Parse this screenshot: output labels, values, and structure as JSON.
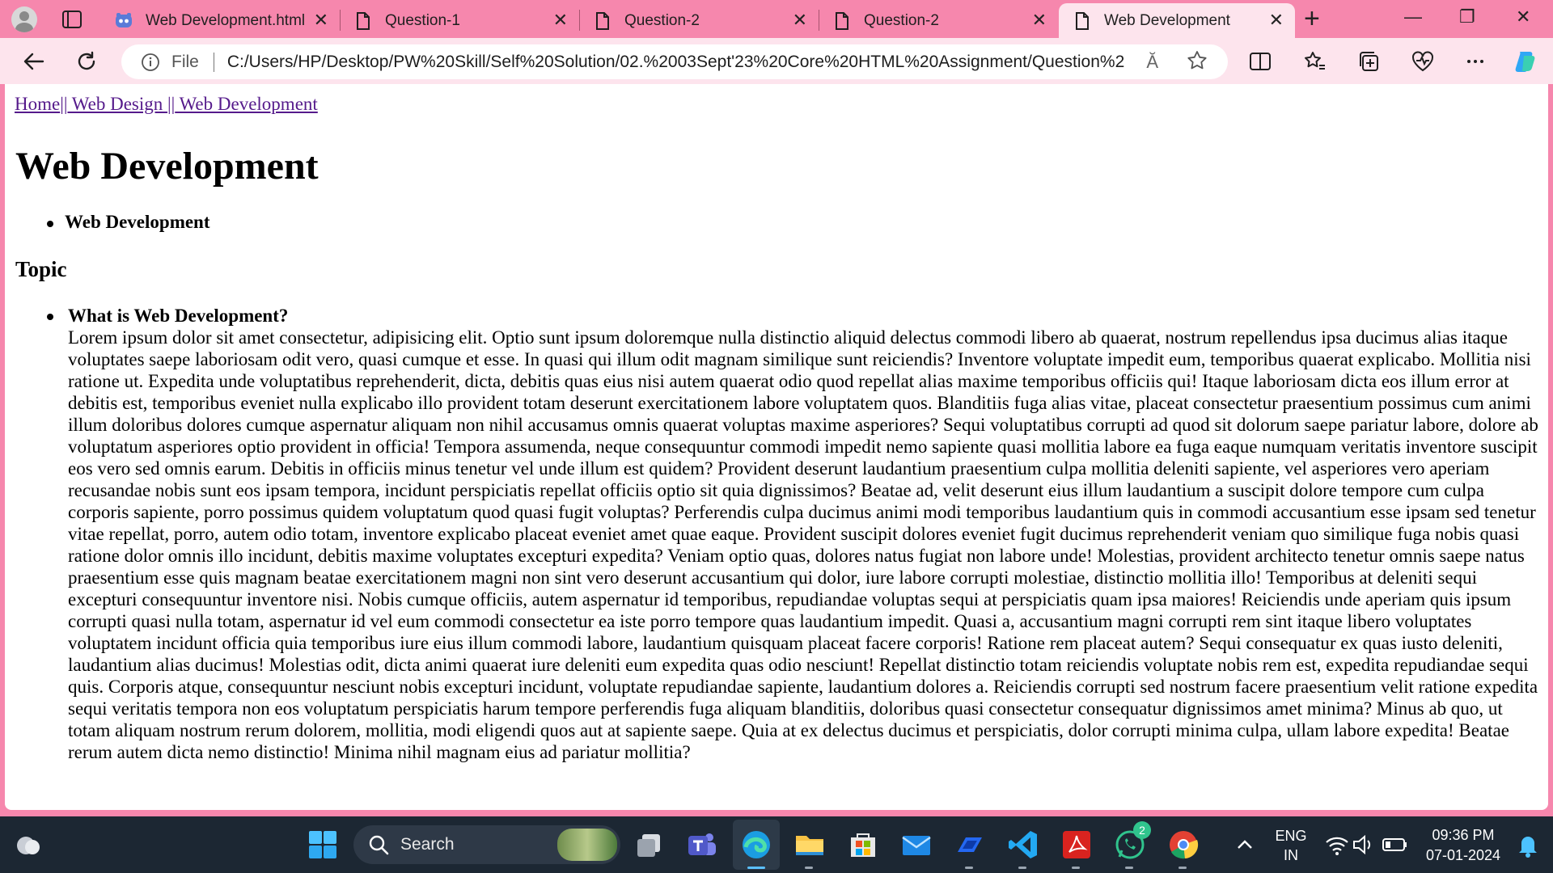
{
  "tabs": [
    {
      "title": "Web Development.html",
      "icon": "copilot-icon",
      "close": "✕"
    },
    {
      "title": "Question-1",
      "icon": "page-icon",
      "close": "✕"
    },
    {
      "title": "Question-2",
      "icon": "page-icon",
      "close": "✕"
    },
    {
      "title": "Question-2",
      "icon": "page-icon",
      "close": "✕"
    },
    {
      "title": "Web Development",
      "icon": "page-icon",
      "close": "✕",
      "active": true
    }
  ],
  "new_tab": "+",
  "window_controls": {
    "minimize": "—",
    "restore": "❐",
    "close": "✕"
  },
  "address_bar": {
    "scheme_label": "File",
    "url": "C:/Users/HP/Desktop/PW%20Skill/Self%20Solution/02.%2003Sept'23%20Core%20HTML%20Assignment/Question%2...",
    "read_aloud": "Ă"
  },
  "page": {
    "breadcrumb": {
      "home": "Home",
      "sep1": "||",
      "web_design": " Web Design ",
      "sep2": "||",
      "web_development": " Web Development"
    },
    "heading": "Web Development",
    "list1_item": "Web Development",
    "topic_heading": "Topic",
    "question": "What is Web Development?",
    "answer": "Lorem ipsum dolor sit amet consectetur, adipisicing elit. Optio sunt ipsum doloremque nulla distinctio aliquid delectus commodi libero ab quaerat, nostrum repellendus ipsa ducimus alias itaque voluptates saepe laboriosam odit vero, quasi cumque et esse. In quasi qui illum odit magnam similique sunt reiciendis? Inventore voluptate impedit eum, temporibus quaerat explicabo. Mollitia nisi ratione ut. Expedita unde voluptatibus reprehenderit, dicta, debitis quas eius nisi autem quaerat odio quod repellat alias maxime temporibus officiis qui! Itaque laboriosam dicta eos illum error at debitis est, temporibus eveniet nulla explicabo illo provident totam deserunt exercitationem labore voluptatem quos. Blanditiis fuga alias vitae, placeat consectetur praesentium possimus cum animi illum doloribus dolores cumque aspernatur aliquam non nihil accusamus omnis quaerat voluptas maxime asperiores? Sequi voluptatibus corrupti ad quod sit dolorum saepe pariatur labore, dolore ab voluptatum asperiores optio provident in officia! Tempora assumenda, neque consequuntur commodi impedit nemo sapiente quasi mollitia labore ea fuga eaque numquam veritatis inventore suscipit eos vero sed omnis earum. Debitis in officiis minus tenetur vel unde illum est quidem? Provident deserunt laudantium praesentium culpa mollitia deleniti sapiente, vel asperiores vero aperiam recusandae nobis sunt eos ipsam tempora, incidunt perspiciatis repellat officiis optio sit quia dignissimos? Beatae ad, velit deserunt eius illum laudantium a suscipit dolore tempore cum culpa corporis sapiente, porro possimus quidem voluptatum quod quasi fugit voluptas? Perferendis culpa ducimus animi modi temporibus laudantium quis in commodi accusantium esse ipsam sed tenetur vitae repellat, porro, autem odio totam, inventore explicabo placeat eveniet amet quae eaque. Provident suscipit dolores eveniet fugit ducimus reprehenderit veniam quo similique fuga nobis quasi ratione dolor omnis illo incidunt, debitis maxime voluptates excepturi expedita? Veniam optio quas, dolores natus fugiat non labore unde! Molestias, provident architecto tenetur omnis saepe natus praesentium esse quis magnam beatae exercitationem magni non sint vero deserunt accusantium qui dolor, iure labore corrupti molestiae, distinctio mollitia illo! Temporibus at deleniti sequi excepturi consequuntur inventore nisi. Nobis cumque officiis, autem aspernatur id temporibus, repudiandae voluptas sequi at perspiciatis quam ipsa maiores! Reiciendis unde aperiam quis ipsum corrupti quasi nulla totam, aspernatur id vel eum commodi consectetur ea iste porro tempore quas laudantium impedit. Quasi a, accusantium magni corrupti rem sint itaque libero voluptates voluptatem incidunt officia quia temporibus iure eius illum commodi labore, laudantium quisquam placeat facere corporis! Ratione rem placeat autem? Sequi consequatur ex quas iusto deleniti, laudantium alias ducimus! Molestias odit, dicta animi quaerat iure deleniti eum expedita quas odio nesciunt! Repellat distinctio totam reiciendis voluptate nobis rem est, expedita repudiandae sequi quis. Corporis atque, consequuntur nesciunt nobis excepturi incidunt, voluptate repudiandae sapiente, laudantium dolores a. Reiciendis corrupti sed nostrum facere praesentium velit ratione expedita sequi veritatis tempora non eos voluptatum perspiciatis harum tempore perferendis fuga aliquam blanditiis, doloribus quasi consectetur consequatur dignissimos amet minima? Minus ab quo, ut totam aliquam nostrum rerum dolorem, mollitia, modi eligendi quos aut at sapiente saepe. Quia at ex delectus ducimus et perspiciatis, dolor corrupti minima culpa, ullam labore expedita! Beatae rerum autem dicta nemo distinctio! Minima nihil magnam eius ad pariatur mollitia?"
  },
  "taskbar": {
    "search_label": "Search",
    "whatsapp_badge": "2",
    "language": "ENG",
    "region": "IN",
    "time": "09:36 PM",
    "date": "07-01-2024"
  },
  "colors": {
    "frame": "#f687ad",
    "toolbar": "#fde4ed",
    "link": "#551a8b",
    "taskbar": "#1c2733"
  }
}
